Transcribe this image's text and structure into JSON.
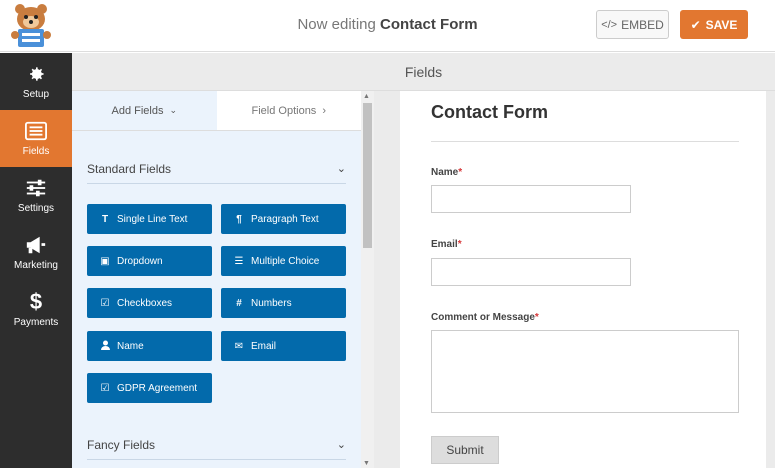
{
  "topbar": {
    "title_prefix": "Now editing",
    "title_name": "Contact Form",
    "embed_label": "EMBED",
    "save_label": "SAVE"
  },
  "sidebar": {
    "items": [
      {
        "label": "Setup",
        "icon": "gear-icon"
      },
      {
        "label": "Fields",
        "icon": "list-icon"
      },
      {
        "label": "Settings",
        "icon": "sliders-icon"
      },
      {
        "label": "Marketing",
        "icon": "megaphone-icon"
      },
      {
        "label": "Payments",
        "icon": "dollar-icon"
      }
    ]
  },
  "panel": {
    "header": "Fields",
    "tabs": [
      "Add Fields",
      "Field Options"
    ],
    "standard_fields_label": "Standard Fields",
    "fancy_fields_label": "Fancy Fields",
    "fields": [
      {
        "label": "Single Line Text",
        "icon": "T"
      },
      {
        "label": "Paragraph Text",
        "icon": "¶"
      },
      {
        "label": "Dropdown",
        "icon": "▣"
      },
      {
        "label": "Multiple Choice",
        "icon": "☰"
      },
      {
        "label": "Checkboxes",
        "icon": "☑"
      },
      {
        "label": "Numbers",
        "icon": "#"
      },
      {
        "label": "Name",
        "icon": "👤"
      },
      {
        "label": "Email",
        "icon": "✉"
      },
      {
        "label": "GDPR Agreement",
        "icon": "☑"
      }
    ]
  },
  "form": {
    "title": "Contact Form",
    "fields": [
      {
        "label": "Name",
        "required": "*"
      },
      {
        "label": "Email",
        "required": "*"
      },
      {
        "label": "Comment or Message",
        "required": "*"
      }
    ],
    "submit_label": "Submit"
  },
  "colors": {
    "accent": "#e27730",
    "field_button": "#036aab",
    "sidebar_bg": "#2d2d2d"
  }
}
